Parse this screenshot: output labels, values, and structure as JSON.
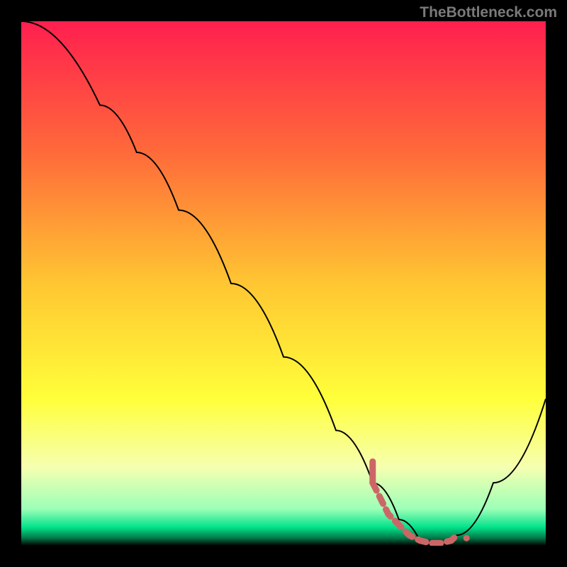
{
  "watermark": "TheBottleneck.com",
  "chart_data": {
    "type": "line",
    "title": "",
    "xlabel": "",
    "ylabel": "",
    "xlim": [
      0,
      100
    ],
    "ylim": [
      0,
      100
    ],
    "series": [
      {
        "name": "bottleneck-curve",
        "color": "#000000",
        "x": [
          0,
          15,
          22,
          30,
          40,
          50,
          60,
          67,
          72,
          76,
          80,
          83,
          90,
          100
        ],
        "y": [
          100,
          84,
          75,
          64,
          50,
          36,
          22,
          12,
          5,
          1,
          0,
          2,
          12,
          28
        ]
      },
      {
        "name": "highlight-segment",
        "color": "#cc6666",
        "style": "dashed-thick",
        "x": [
          67,
          68,
          69,
          70,
          72,
          74,
          76,
          78,
          80,
          82,
          83
        ],
        "y": [
          12,
          10,
          8,
          6,
          4,
          2,
          1,
          0.5,
          0.5,
          1,
          2
        ]
      }
    ],
    "background_gradient": {
      "type": "vertical",
      "stops": [
        {
          "pos": 0.0,
          "color": "#ff1f4f"
        },
        {
          "pos": 0.25,
          "color": "#ff6a3a"
        },
        {
          "pos": 0.5,
          "color": "#ffc632"
        },
        {
          "pos": 0.72,
          "color": "#ffff3a"
        },
        {
          "pos": 0.85,
          "color": "#f6ffb0"
        },
        {
          "pos": 0.93,
          "color": "#9cffb8"
        },
        {
          "pos": 0.965,
          "color": "#00e28a"
        },
        {
          "pos": 0.985,
          "color": "#007a4a"
        },
        {
          "pos": 1.0,
          "color": "#000000"
        }
      ]
    }
  }
}
